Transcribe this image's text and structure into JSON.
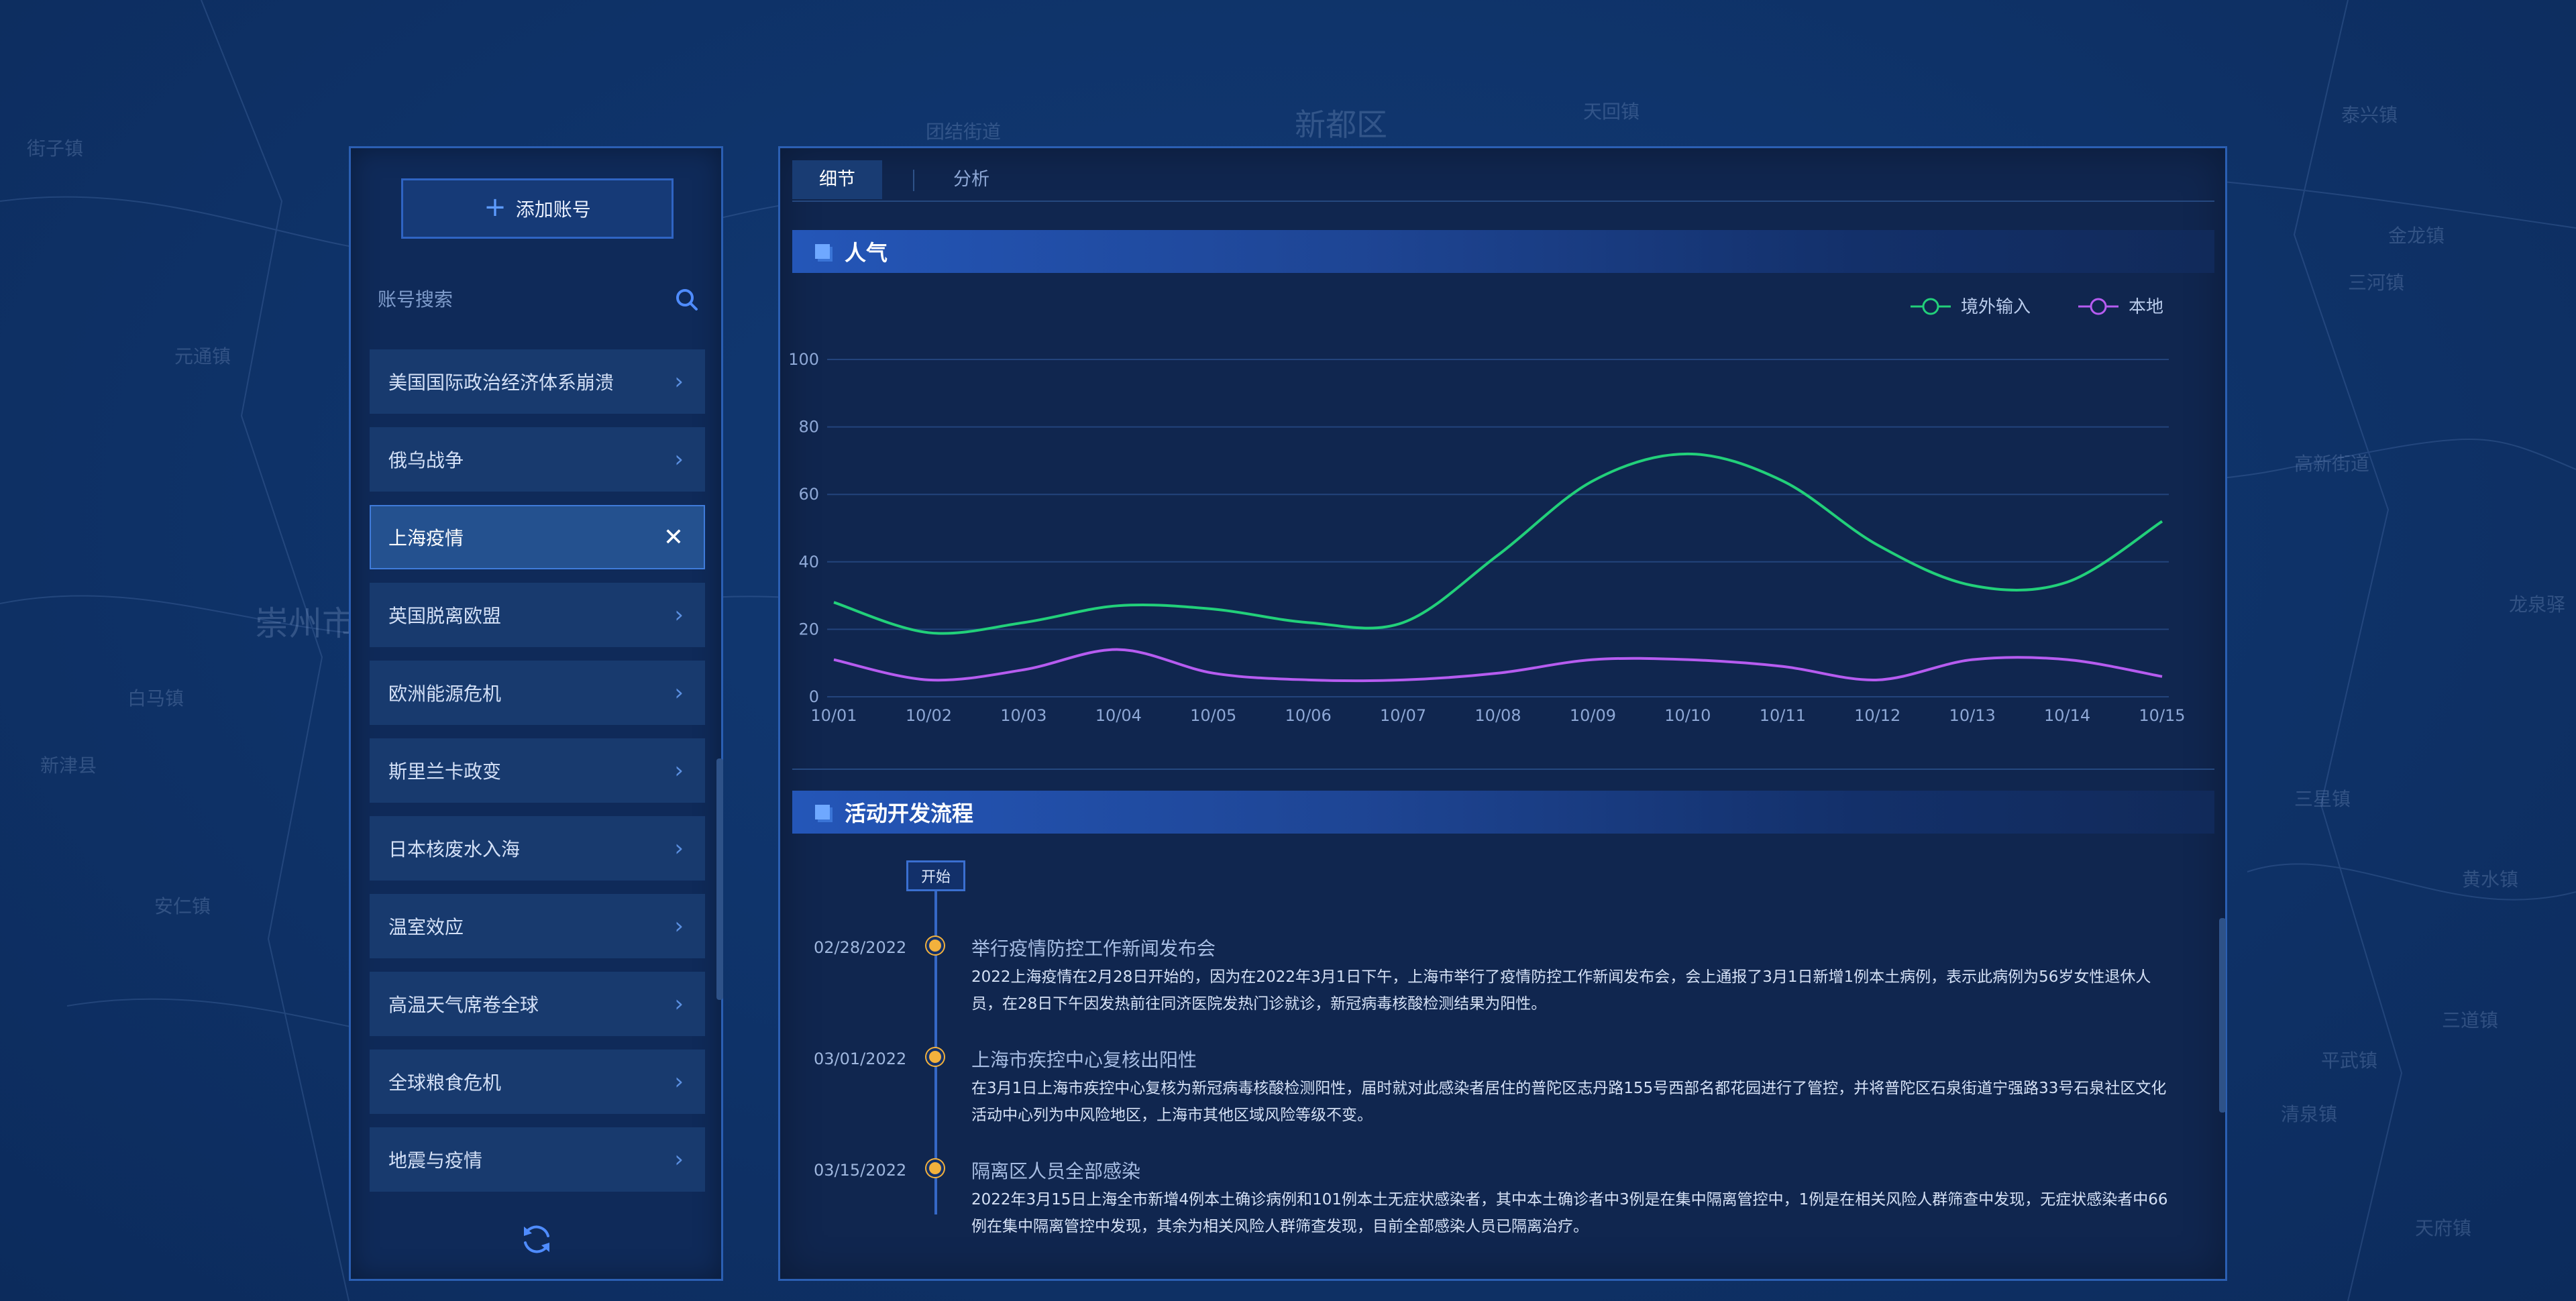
{
  "map": {
    "labels": [
      "新都区",
      "团结街道",
      "天回镇",
      "三河镇",
      "泰兴镇",
      "清泉镇",
      "三星镇",
      "高新街道",
      "三道镇",
      "天府镇",
      "崇州市",
      "元通镇",
      "街子镇",
      "安仁镇",
      "新津县",
      "金龙镇",
      "白马镇",
      "黄水镇",
      "平武镇",
      "龙泉驿"
    ]
  },
  "sidebar": {
    "add_button_label": "添加账号",
    "search_placeholder": "账号搜索",
    "items": [
      {
        "label": "美国国际政治经济体系崩溃",
        "active": false
      },
      {
        "label": "俄乌战争",
        "active": false
      },
      {
        "label": "上海疫情",
        "active": true
      },
      {
        "label": "英国脱离欧盟",
        "active": false
      },
      {
        "label": "欧洲能源危机",
        "active": false
      },
      {
        "label": "斯里兰卡政变",
        "active": false
      },
      {
        "label": "日本核废水入海",
        "active": false
      },
      {
        "label": "温室效应",
        "active": false
      },
      {
        "label": "高温天气席卷全球",
        "active": false
      },
      {
        "label": "全球粮食危机",
        "active": false
      },
      {
        "label": "地震与疫情",
        "active": false
      }
    ]
  },
  "tabs": [
    {
      "label": "细节",
      "active": true
    },
    {
      "label": "分析",
      "active": false
    }
  ],
  "popularity": {
    "title": "人气"
  },
  "chart_data": {
    "type": "line",
    "x": [
      "10/01",
      "10/02",
      "10/03",
      "10/04",
      "10/05",
      "10/06",
      "10/07",
      "10/08",
      "10/09",
      "10/10",
      "10/11",
      "10/12",
      "10/13",
      "10/14",
      "10/15"
    ],
    "ylim": [
      0,
      100
    ],
    "yticks": [
      "0",
      "20",
      "40",
      "60",
      "80",
      "100"
    ],
    "legend_position": "top-right",
    "grid": true,
    "series": [
      {
        "name": "境外输入",
        "color": "#22d07a",
        "values": [
          28,
          19,
          22,
          27,
          26,
          22,
          22,
          42,
          64,
          72,
          64,
          45,
          33,
          34,
          52
        ]
      },
      {
        "name": "本地",
        "color": "#b65cf0",
        "values": [
          11,
          5,
          8,
          14,
          7,
          5,
          5,
          7,
          11,
          11,
          9,
          5,
          11,
          11,
          6
        ]
      }
    ]
  },
  "process": {
    "title": "活动开发流程",
    "start_label": "开始",
    "events": [
      {
        "date": "02/28/2022",
        "title": "举行疫情防控工作新闻发布会",
        "desc": "2022上海疫情在2月28日开始的，因为在2022年3月1日下午，上海市举行了疫情防控工作新闻发布会，会上通报了3月1日新增1例本土病例，表示此病例为56岁女性退休人员，在28日下午因发热前往同济医院发热门诊就诊，新冠病毒核酸检测结果为阳性。"
      },
      {
        "date": "03/01/2022",
        "title": "上海市疾控中心复核出阳性",
        "desc": "在3月1日上海市疾控中心复核为新冠病毒核酸检测阳性，届时就对此感染者居住的普陀区志丹路155号西部名都花园进行了管控，并将普陀区石泉街道宁强路33号石泉社区文化活动中心列为中风险地区，上海市其他区域风险等级不变。"
      },
      {
        "date": "03/15/2022",
        "title": "隔离区人员全部感染",
        "desc": "2022年3月15日上海全市新增4例本土确诊病例和101例本土无症状感染者，其中本土确诊者中3例是在集中隔离管控中，1例是在相关风险人群筛查中发现，无症状感染者中66例在集中隔离管控中发现，其余为相关风险人群筛查发现，目前全部感染人员已隔离治疗。"
      }
    ]
  },
  "colors": {
    "accent": "#3a74d6",
    "panel_border": "#2b5fb3",
    "dot": "#f3b13c"
  }
}
